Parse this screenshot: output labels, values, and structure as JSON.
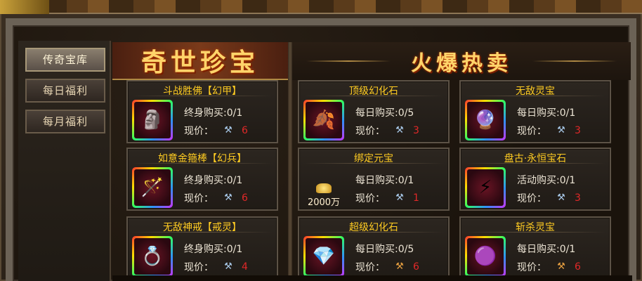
{
  "nav": {
    "items": [
      {
        "label": "传奇宝库",
        "active": true
      },
      {
        "label": "每日福利",
        "active": false
      },
      {
        "label": "每月福利",
        "active": false
      }
    ]
  },
  "sections": {
    "left_title": "奇世珍宝",
    "right_title": "火爆热卖"
  },
  "price_label": "现价：",
  "cards": [
    {
      "name": "斗战胜佛【幻甲】",
      "limit": "终身购买:0/1",
      "price": "6",
      "icon": "armor-icon",
      "currency": "blue"
    },
    {
      "name": "如意金箍棒【幻兵】",
      "limit": "终身购买:0/1",
      "price": "6",
      "icon": "staff-icon",
      "currency": "blue"
    },
    {
      "name": "无敌神戒【戒灵】",
      "limit": "终身购买:0/1",
      "price": "4",
      "icon": "ring-icon",
      "currency": "blue"
    },
    {
      "name": "顶级幻化石",
      "limit": "每日购买:0/5",
      "price": "3",
      "icon": "gold-stone-icon",
      "currency": "blue"
    },
    {
      "name": "绑定元宝",
      "limit": "每日购买:0/1",
      "price": "1",
      "icon": "gold-ingot-icon",
      "currency": "blue",
      "amount": "2000万"
    },
    {
      "name": "超级幻化石",
      "limit": "每日购买:0/5",
      "price": "6",
      "icon": "blue-crystal-icon",
      "currency": "orange"
    },
    {
      "name": "无敌灵宝",
      "limit": "每日购买:0/1",
      "price": "3",
      "icon": "spirit-treasure-icon",
      "currency": "blue"
    },
    {
      "name": "盘古·永恒宝石",
      "limit": "活动购买:0/1",
      "price": "3",
      "icon": "gem-icon",
      "currency": "blue"
    },
    {
      "name": "斩杀灵宝",
      "limit": "每日购买:0/1",
      "price": "6",
      "icon": "purple-orb-icon",
      "currency": "orange"
    }
  ]
}
